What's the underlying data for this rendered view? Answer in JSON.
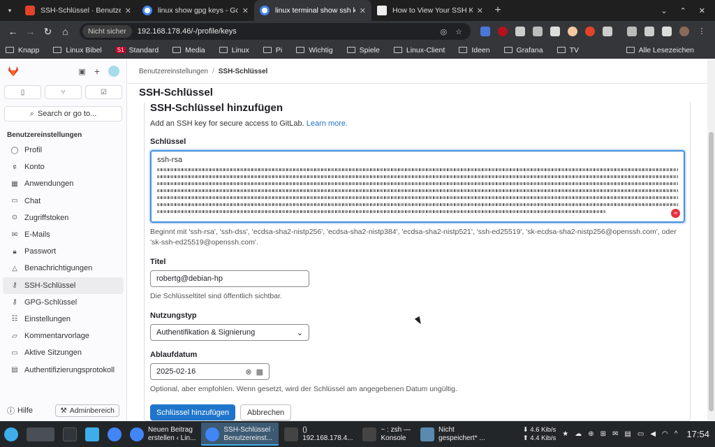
{
  "browser": {
    "tabs": [
      {
        "title": "SSH-Schlüssel · Benutzerein",
        "favicon_color": "#e24329",
        "active": false
      },
      {
        "title": "linux show gpg keys - Goog",
        "favicon_color": "#4285f4",
        "active": false
      },
      {
        "title": "linux terminal show ssh key",
        "favicon_color": "#4285f4",
        "active": true
      },
      {
        "title": "How to View Your SSH Keys",
        "favicon_color": "#f0f0f0",
        "active": false
      }
    ],
    "new_tab": "+",
    "security_label": "Nicht sicher",
    "url": "192.168.178.46/-/profile/keys",
    "bookmarks": [
      "Knapp",
      "Linux Bibel",
      "Standard",
      "Media",
      "Linux",
      "Pi",
      "Wichtig",
      "Spiele",
      "Linux-Client",
      "Ideen",
      "Grafana",
      "TV"
    ],
    "all_bookmarks": "Alle Lesezeichen"
  },
  "sidebar": {
    "search_placeholder": "Search or go to...",
    "section_title": "Benutzereinstellungen",
    "items": [
      {
        "label": "Profil",
        "icon": "user-icon"
      },
      {
        "label": "Konto",
        "icon": "account-icon"
      },
      {
        "label": "Anwendungen",
        "icon": "grid-icon"
      },
      {
        "label": "Chat",
        "icon": "chat-icon"
      },
      {
        "label": "Zugriffstoken",
        "icon": "token-icon"
      },
      {
        "label": "E-Mails",
        "icon": "mail-icon"
      },
      {
        "label": "Passwort",
        "icon": "lock-icon"
      },
      {
        "label": "Benachrichtigungen",
        "icon": "bell-icon"
      },
      {
        "label": "SSH-Schlüssel",
        "icon": "key-icon",
        "active": true
      },
      {
        "label": "GPG-Schlüssel",
        "icon": "key-icon"
      },
      {
        "label": "Einstellungen",
        "icon": "preferences-icon"
      },
      {
        "label": "Kommentarvorlage",
        "icon": "comment-icon"
      },
      {
        "label": "Aktive Sitzungen",
        "icon": "monitor-icon"
      },
      {
        "label": "Authentifizierungsprotokoll",
        "icon": "log-icon"
      }
    ],
    "help_label": "Hilfe",
    "admin_label": "Adminbereich"
  },
  "main": {
    "breadcrumb_parent": "Benutzereinstellungen",
    "breadcrumb_current": "SSH-Schlüssel",
    "page_title": "SSH-Schlüssel",
    "card_title": "SSH-Schlüssel hinzufügen",
    "description": "Add an SSH key for secure access to GitLab.",
    "learn_more": "Learn more.",
    "key_label": "Schlüssel",
    "key_prefix": "ssh-rsa",
    "key_hint": "Beginnt mit 'ssh-rsa', 'ssh-dss', 'ecdsa-sha2-nistp256', 'ecdsa-sha2-nistp384', 'ecdsa-sha2-nistp521', 'ssh-ed25519', 'sk-ecdsa-sha2-nistp256@openssh.com', oder 'sk-ssh-ed25519@openssh.com'.",
    "title_label": "Titel",
    "title_value": "robertg@debian-hp",
    "title_hint": "Die Schlüsseltitel sind öffentlich sichtbar.",
    "usage_label": "Nutzungstyp",
    "usage_value": "Authentifikation & Signierung",
    "expiry_label": "Ablaufdatum",
    "expiry_value": "2025-02-16",
    "expiry_hint": "Optional, aber empfohlen. Wenn gesetzt, wird der Schlüssel am angegebenen Datum ungültig.",
    "submit_label": "Schlüssel hinzufügen",
    "cancel_label": "Abbrechen"
  },
  "taskbar": {
    "tasks": [
      {
        "line1": "Neuen Beitrag",
        "line2": "erstellen ‹ Lin...",
        "icon_color": "#4285f4"
      },
      {
        "line1": "SSH-Schlüssel ·",
        "line2": "Benutzereinst...",
        "icon_color": "#4285f4",
        "active": true
      },
      {
        "line1": "()",
        "line2": "192.168.178.4...",
        "icon_color": "#444"
      },
      {
        "line1": "~ : zsh —",
        "line2": "Konsole",
        "icon_color": "#444"
      },
      {
        "line1": "Nicht",
        "line2": "gespeichert* ...",
        "icon_color": "#5a8ab0"
      }
    ],
    "net_down": "4.6 Kib/s",
    "net_up": "4.4 Kib/s",
    "clock": "17:54"
  }
}
